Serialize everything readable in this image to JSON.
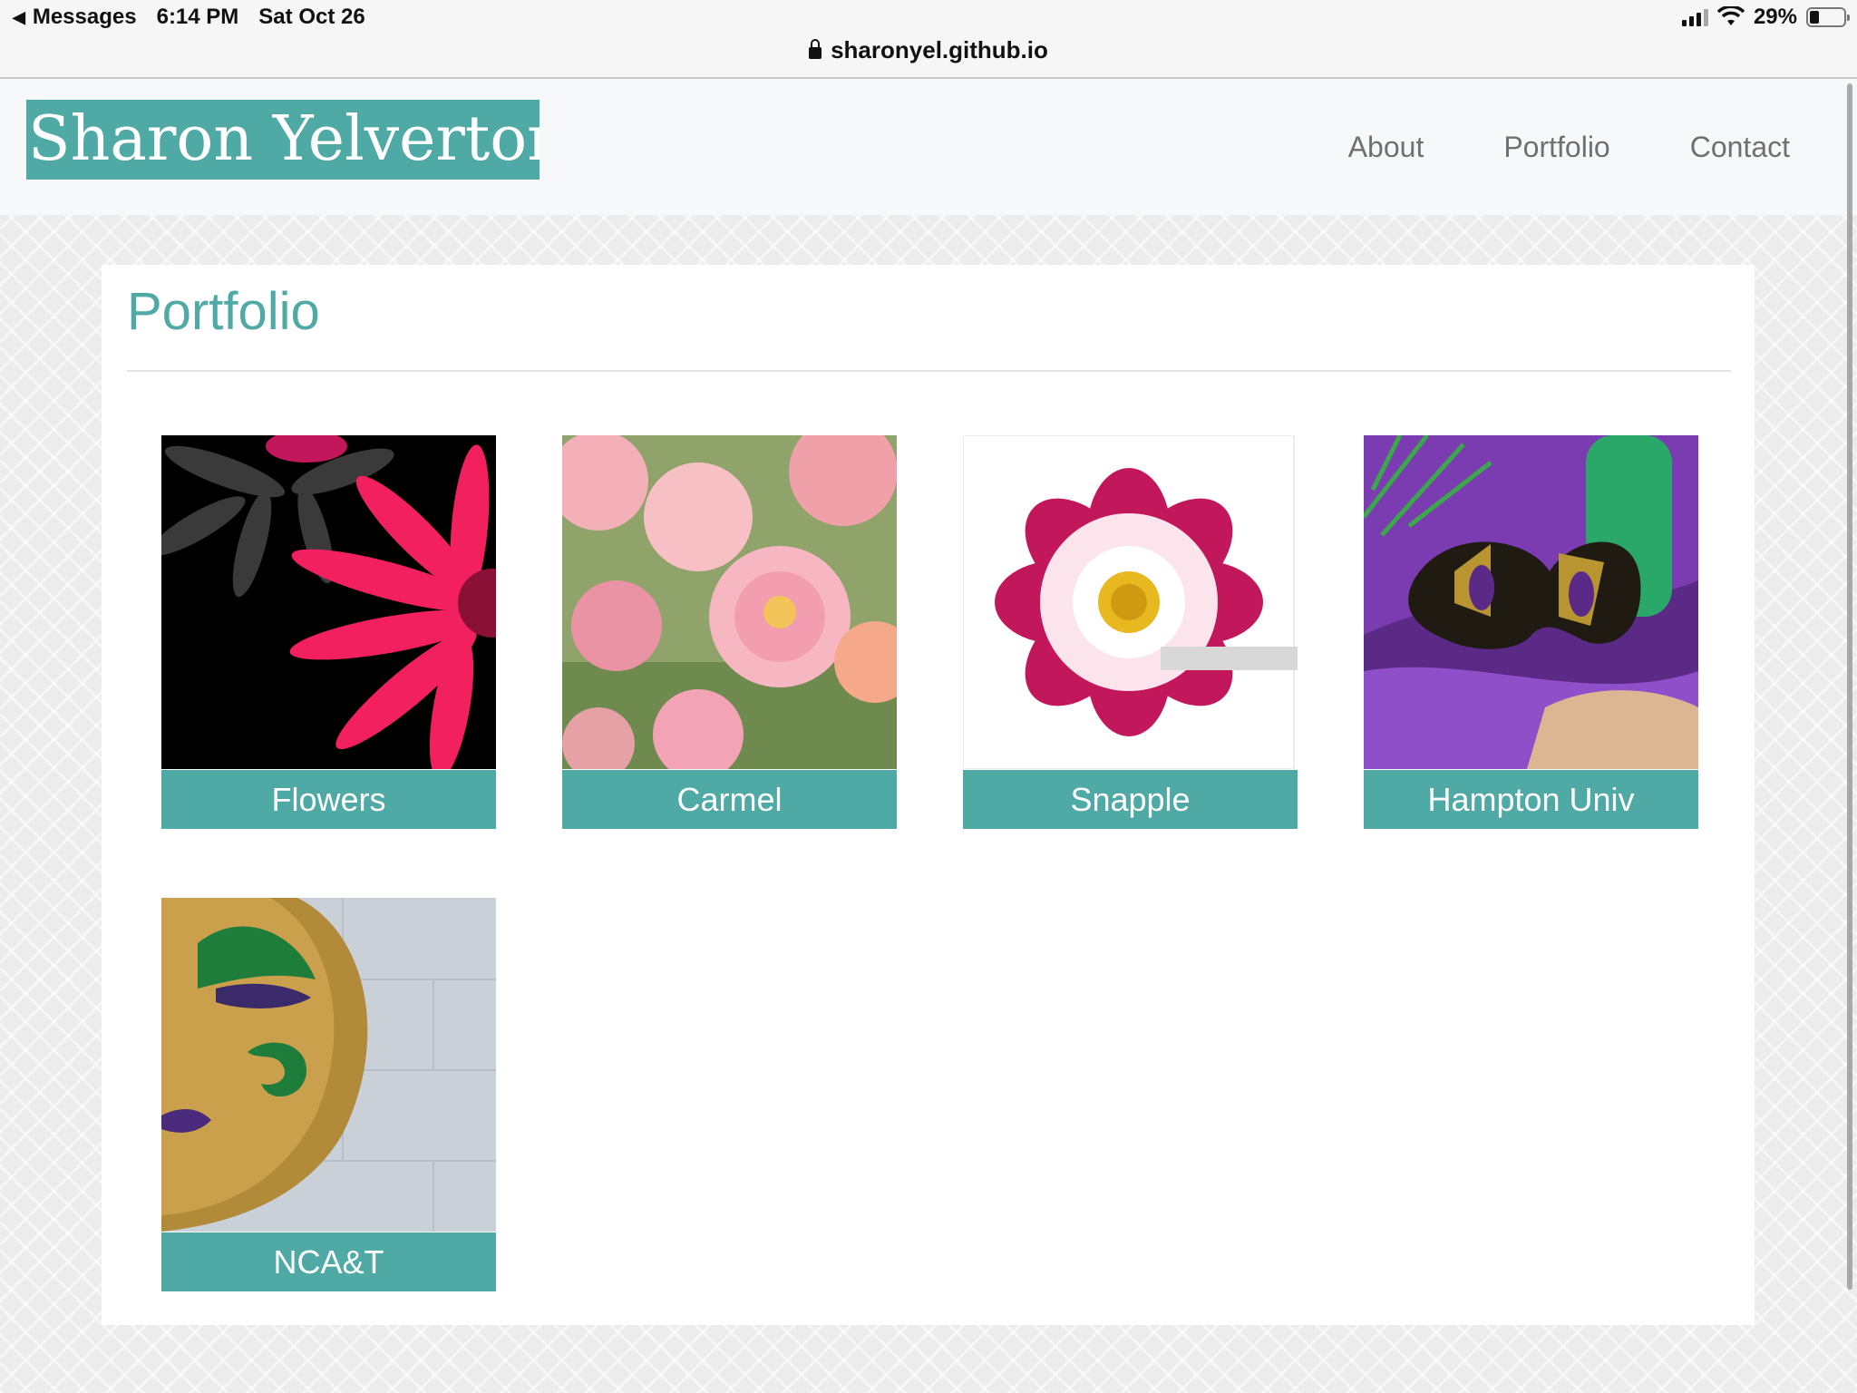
{
  "status_bar": {
    "back_app": "Messages",
    "time": "6:14 PM",
    "date": "Sat Oct 26",
    "battery": "29%",
    "battery_level": 0.29
  },
  "browser": {
    "url": "sharonyel.github.io"
  },
  "site": {
    "brand": "Sharon Yelverton",
    "nav": [
      {
        "label": "About"
      },
      {
        "label": "Portfolio"
      },
      {
        "label": "Contact"
      }
    ]
  },
  "page": {
    "title": "Portfolio",
    "tiles": [
      {
        "caption": "Flowers",
        "image": "pink-daisy-on-black"
      },
      {
        "caption": "Carmel",
        "image": "pink-dahlias"
      },
      {
        "caption": "Snapple",
        "image": "pink-cosmos-flower"
      },
      {
        "caption": "Hampton Univ",
        "image": "gold-black-masquerade-mask"
      },
      {
        "caption": "NCA&T",
        "image": "gold-mardi-gras-mask"
      }
    ]
  },
  "colors": {
    "accent": "#4fa9a4",
    "nav_text": "#707070"
  }
}
